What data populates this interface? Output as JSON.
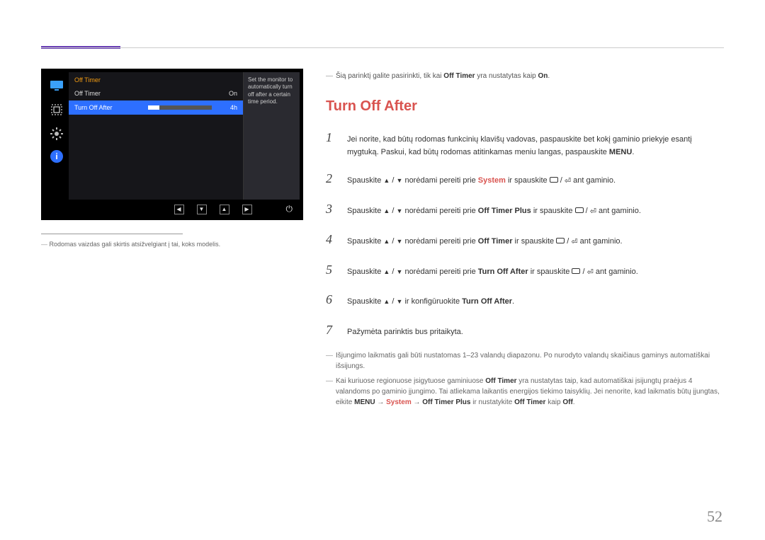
{
  "osd": {
    "title": "Off Timer",
    "rows": [
      {
        "label": "Off Timer",
        "value": "On"
      },
      {
        "label": "Turn Off After",
        "value": "4h"
      }
    ],
    "description": "Set the monitor to automatically turn off after a certain time period.",
    "icons": [
      "screen-icon",
      "picture-icon",
      "gear-icon",
      "info-icon"
    ]
  },
  "caption": "Rodomas vaizdas gali skirtis atsižvelgiant į tai, koks modelis.",
  "intro_note": {
    "prefix": "Šią parinktį galite pasirinkti, tik kai ",
    "bold1": "Off Timer",
    "mid": " yra nustatytas kaip ",
    "bold2": "On",
    "suffix": "."
  },
  "heading": "Turn Off After",
  "steps": {
    "s1": {
      "a": "Jei norite, kad būtų rodomas funkcinių klavišų vadovas, paspauskite bet kokį gaminio priekyje esantį mygtuką. Paskui, kad būtų rodomas atitinkamas meniu langas, paspauskite ",
      "menu": "MENU",
      "b": "."
    },
    "s2": {
      "a": "Spauskite ",
      "b": " norėdami pereiti prie ",
      "target": "System",
      "c": " ir spauskite ",
      "d": " ant gaminio."
    },
    "s3": {
      "a": "Spauskite ",
      "b": " norėdami pereiti prie ",
      "target": "Off Timer Plus",
      "c": " ir spauskite ",
      "d": " ant gaminio."
    },
    "s4": {
      "a": "Spauskite ",
      "b": " norėdami pereiti prie ",
      "target": "Off Timer",
      "c": " ir spauskite ",
      "d": " ant gaminio."
    },
    "s5": {
      "a": "Spauskite ",
      "b": " norėdami pereiti prie ",
      "target": "Turn Off After",
      "c": " ir spauskite ",
      "d": " ant gaminio."
    },
    "s6": {
      "a": "Spauskite ",
      "b": " ir konfigūruokite ",
      "target": "Turn Off After",
      "c": "."
    },
    "s7": "Pažymėta parinktis bus pritaikyta."
  },
  "foot1": "Išjungimo laikmatis gali būti nustatomas 1–23 valandų diapazonu. Po nurodyto valandų skaičiaus gaminys automatiškai išsijungs.",
  "foot2": {
    "a": "Kai kuriuose regionuose įsigytuose gaminiuose ",
    "b": "Off Timer",
    "c": " yra nustatytas taip, kad automatiškai įsijungtų praėjus 4 valandoms po gaminio įjungimo. Tai atliekama laikantis energijos tiekimo taisyklių. Jei nenorite, kad laikmatis būtų įjungtas, eikite ",
    "menu": "MENU",
    "arrow": " → ",
    "sys": "System",
    "otp": "Off Timer Plus",
    "d": " ir nustatykite ",
    "ot": "Off Timer",
    "e": " kaip ",
    "off": "Off",
    "f": "."
  },
  "page": "52"
}
